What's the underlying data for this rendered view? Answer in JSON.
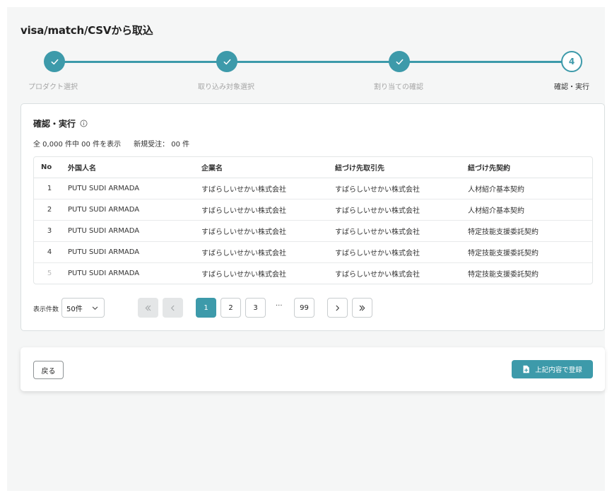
{
  "page": {
    "title": "visa/match/CSVから取込"
  },
  "stepper": {
    "steps": [
      {
        "label": "プロダクト選択",
        "number": "1",
        "status": "done"
      },
      {
        "label": "取り込み対象選択",
        "number": "2",
        "status": "done"
      },
      {
        "label": "割り当ての確認",
        "number": "3",
        "status": "done"
      },
      {
        "label": "確認・実行",
        "number": "4",
        "status": "current"
      }
    ]
  },
  "card": {
    "title": "確認・実行",
    "count_text": "全 0,000 件中  00 件を表示",
    "new_orders_text": "新規受注： 00 件"
  },
  "table": {
    "headers": [
      "No",
      "外国人名",
      "企業名",
      "紐づけ先取引先",
      "紐づけ先契約"
    ],
    "rows": [
      [
        "1",
        "PUTU SUDI ARMADA",
        "すばらしいせかい株式会社",
        "すばらしいせかい株式会社",
        "人材紹介基本契約"
      ],
      [
        "2",
        "PUTU SUDI ARMADA",
        "すばらしいせかい株式会社",
        "すばらしいせかい株式会社",
        "人材紹介基本契約"
      ],
      [
        "3",
        "PUTU SUDI ARMADA",
        "すばらしいせかい株式会社",
        "すばらしいせかい株式会社",
        "特定技能支援委託契約"
      ],
      [
        "4",
        "PUTU SUDI ARMADA",
        "すばらしいせかい株式会社",
        "すばらしいせかい株式会社",
        "特定技能支援委託契約"
      ],
      [
        "5",
        "PUTU SUDI ARMADA",
        "すばらしいせかい株式会社",
        "すばらしいせかい株式会社",
        "特定技能支援委託契約"
      ]
    ]
  },
  "pagination": {
    "per_page_label": "表示件数",
    "per_page_value": "50件",
    "pages": [
      "1",
      "2",
      "3",
      "99"
    ],
    "current_page": "1",
    "ellipsis": "···"
  },
  "actions": {
    "back_label": "戻る",
    "register_label": "上記内容で登録"
  },
  "colors": {
    "accent": "#3d9aaa",
    "background": "#f5f6f6"
  },
  "icons": [
    "check-icon",
    "info-icon",
    "chevron-down-icon",
    "double-chevron-left-icon",
    "chevron-left-icon",
    "chevron-right-icon",
    "double-chevron-right-icon",
    "document-icon"
  ]
}
